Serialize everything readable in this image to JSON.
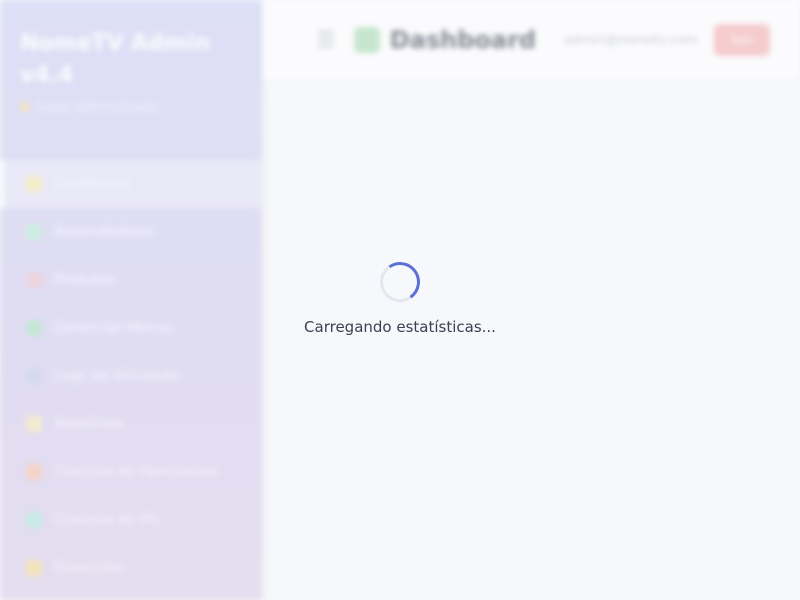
{
  "app": {
    "brand": {
      "title": "NomeTV Admin v4.4",
      "subtitle": "Super Administrador"
    },
    "sidebar": {
      "items": [
        {
          "label": "Dashboard",
          "icon": "chart-icon",
          "color": "#f3e6a0",
          "active": true
        },
        {
          "label": "Revendedores",
          "icon": "users-icon",
          "color": "#a9e6c9"
        },
        {
          "label": "Produtos",
          "icon": "package-icon",
          "color": "#e6b8c8"
        },
        {
          "label": "Gerenciar Menus",
          "icon": "phone-icon",
          "color": "#9fd8b8"
        },
        {
          "label": "Logs de Atividade",
          "icon": "pencil-icon",
          "color": "#b9c0e6"
        },
        {
          "label": "Relatórios",
          "icon": "report-icon",
          "color": "#f3e0b0"
        },
        {
          "label": "Controle de Permissões",
          "icon": "lock-icon",
          "color": "#f2b7a0"
        },
        {
          "label": "Controle de IPs",
          "icon": "globe-icon",
          "color": "#9fe0d8"
        },
        {
          "label": "Financeiro",
          "icon": "money-icon",
          "color": "#f3d48a"
        }
      ]
    },
    "topbar": {
      "title": "Dashboard",
      "email": "admin@nometv.com",
      "logout_label": "Sair"
    }
  },
  "loading": {
    "text": "Carregando estatísticas..."
  },
  "colors": {
    "accent": "#5b6fd8",
    "sidebar_start": "#c9ccf3",
    "sidebar_end": "#d6c8e6",
    "logout": "#f4a8a8"
  }
}
